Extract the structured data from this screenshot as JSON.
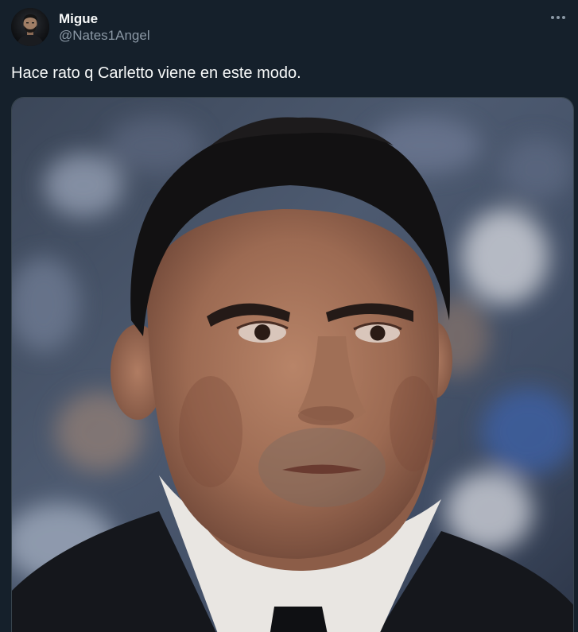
{
  "author": {
    "display_name": "Migue",
    "handle": "@Nates1Angel",
    "avatar_icon": "avatar-photo"
  },
  "tweet": {
    "text": "Hace rato q Carletto viene en este modo."
  },
  "actions": {
    "more_icon": "more-horizontal-icon"
  },
  "colors": {
    "background": "#15202b",
    "primary_text": "#f7f9f9",
    "secondary_text": "#8b98a5",
    "border": "#38444d"
  }
}
